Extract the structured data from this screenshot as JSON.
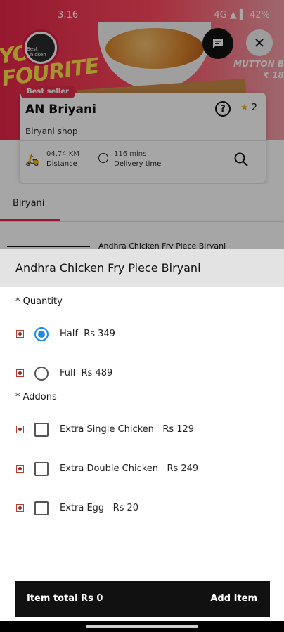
{
  "status_bar": {
    "time": "3:16",
    "right": "4G ▲ ▌ 42%"
  },
  "banner": {
    "left_text_line1": "YOU",
    "left_text_line2": "FOURITE",
    "right_text": "MUTTON B",
    "price": "₹ 18"
  },
  "logo": {
    "text": "Best Chicken"
  },
  "restaurant": {
    "badge": "Best seller",
    "name": "AN Briyani",
    "type": "Biryani shop",
    "rating": "2",
    "distance_value": "04.74 KM",
    "distance_label": "Distance",
    "time_value": "116 mins",
    "time_label": "Delivery time"
  },
  "tabs": [
    {
      "label": "Biryani"
    }
  ],
  "peek_item": "Andhra Chicken Fry Piece Biryani",
  "sheet": {
    "title": "Andhra Chicken Fry Piece Biryani",
    "quantity_label": "* Quantity",
    "quantity_options": [
      {
        "name": "Half",
        "price": "Rs 349",
        "selected": true
      },
      {
        "name": "Full",
        "price": "Rs 489",
        "selected": false
      }
    ],
    "addons_label": "* Addons",
    "addons": [
      {
        "name": "Extra Single Chicken",
        "price": "Rs 129",
        "checked": false
      },
      {
        "name": "Extra Double Chicken",
        "price": "Rs 249",
        "checked": false
      },
      {
        "name": "Extra Egg",
        "price": "Rs 20",
        "checked": false
      }
    ]
  },
  "footer": {
    "total": "Item total Rs 0",
    "add": "Add Item"
  },
  "colors": {
    "accent": "#e8264a",
    "radio_selected": "#1e88e5",
    "footer_bg": "#111111"
  }
}
